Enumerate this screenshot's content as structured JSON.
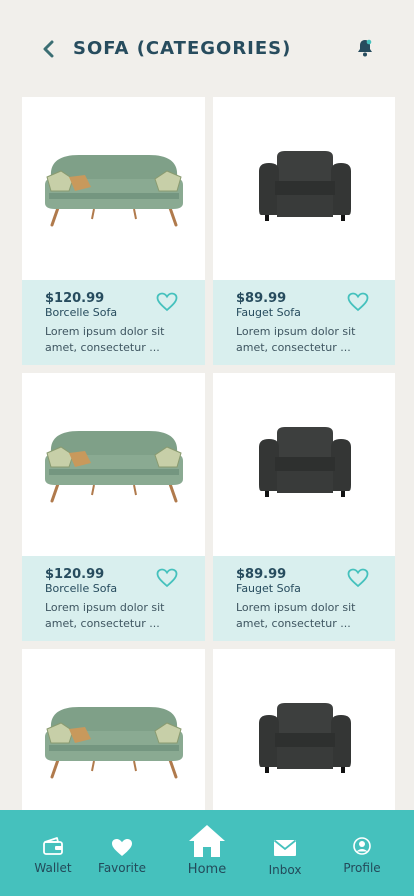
{
  "header": {
    "title": "SOFA (CATEGORIES)"
  },
  "products": [
    {
      "price": "$120.99",
      "name": "Borcelle Sofa",
      "description": "Lorem ipsum dolor sit amet, consectetur ...",
      "image": "green-sofa"
    },
    {
      "price": "$89.99",
      "name": "Fauget Sofa",
      "description": "Lorem ipsum dolor sit amet, consectetur ...",
      "image": "black-armchair"
    },
    {
      "price": "$120.99",
      "name": "Borcelle Sofa",
      "description": "Lorem ipsum dolor sit amet, consectetur ...",
      "image": "green-sofa"
    },
    {
      "price": "$89.99",
      "name": "Fauget Sofa",
      "description": "Lorem ipsum dolor sit amet, consectetur ...",
      "image": "black-armchair"
    },
    {
      "image": "green-sofa"
    },
    {
      "image": "black-armchair"
    }
  ],
  "nav": {
    "wallet": "Wallet",
    "favorite": "Favorite",
    "home": "Home",
    "inbox": "Inbox",
    "profile": "Profile"
  },
  "colors": {
    "title": "#274c5e",
    "card_info_bg": "#d9efee",
    "nav_bg": "#45c1bd",
    "heart_outline": "#45c1bd",
    "page_bg": "#f1efeb"
  }
}
